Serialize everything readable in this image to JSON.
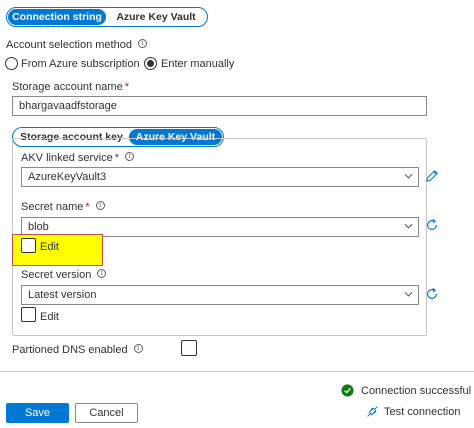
{
  "auth_tabs": {
    "connection_string": "Connection string",
    "akv": "Azure Key Vault"
  },
  "account_selection": {
    "label": "Account selection method",
    "option_subscription": "From Azure subscription",
    "option_manual": "Enter manually",
    "selected": "Enter manually"
  },
  "storage_account": {
    "label": "Storage account name",
    "required": "*",
    "value": "bhargavaadfstorage"
  },
  "key_tabs": {
    "storage_key": "Storage account key",
    "akv": "Azure Key Vault",
    "selected": "Azure Key Vault"
  },
  "akv_linked_service": {
    "label": "AKV linked service",
    "required": "*",
    "value": "AzureKeyVault3"
  },
  "secret_name": {
    "label": "Secret name",
    "required": "*",
    "value": "blob",
    "edit_label": "Edit",
    "edit_checked": false
  },
  "secret_version": {
    "label": "Secret version",
    "value": "Latest version",
    "edit_label": "Edit",
    "edit_checked": false
  },
  "partitioned_dns": {
    "label": "Partioned DNS enabled",
    "checked": false
  },
  "status": {
    "connection": "Connection successful",
    "test": "Test connection"
  },
  "buttons": {
    "save": "Save",
    "cancel": "Cancel"
  },
  "colors": {
    "accent": "#0078d4",
    "success": "#107c10",
    "highlight": "#ffff00",
    "required": "#a4262c"
  },
  "icons": [
    "info-icon",
    "chevron-down-icon",
    "pencil-icon",
    "refresh-icon",
    "checkmark-circle-icon",
    "test-connection-icon"
  ]
}
